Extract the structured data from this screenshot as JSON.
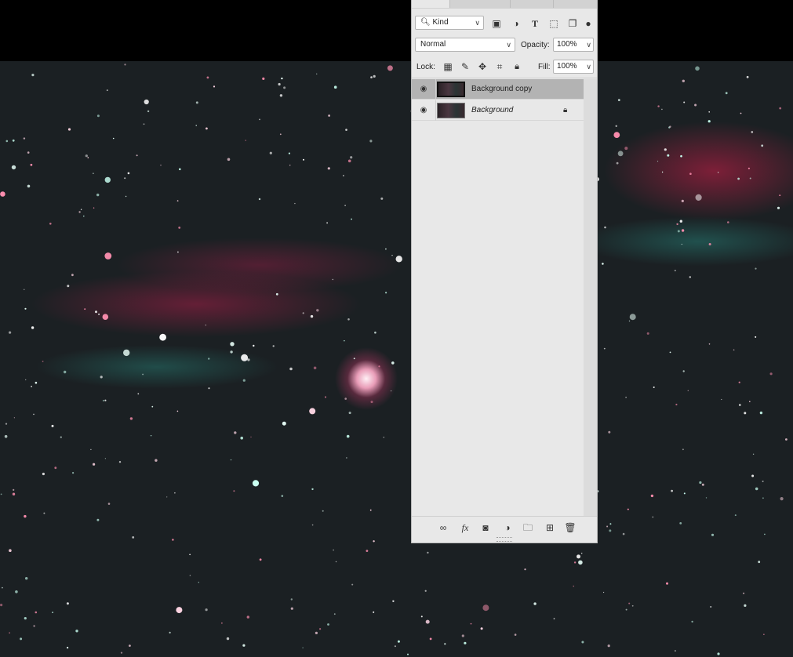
{
  "panel": {
    "tabs": [
      "",
      "",
      ""
    ],
    "filter": {
      "value": "Kind",
      "icons": [
        "image-filter-icon",
        "adjustment-filter-icon",
        "type-filter-icon",
        "shape-filter-icon",
        "smart-object-filter-icon",
        "filter-toggle-icon"
      ]
    },
    "blend_mode": "Normal",
    "opacity_label": "Opacity:",
    "opacity_value": "100%",
    "lock_label": "Lock:",
    "lock_icons": [
      "lock-transparent-pixels-icon",
      "lock-image-pixels-icon",
      "lock-position-icon",
      "lock-artboard-icon",
      "lock-all-icon"
    ],
    "fill_label": "Fill:",
    "fill_value": "100%",
    "layers": [
      {
        "name": "Background copy",
        "visible": true,
        "selected": true,
        "locked": false
      },
      {
        "name": "Background",
        "visible": true,
        "selected": false,
        "locked": true
      }
    ],
    "bottom_icons": [
      "link-layers-icon",
      "fx-icon",
      "add-mask-icon",
      "new-adjustment-layer-icon",
      "new-group-icon",
      "new-layer-icon",
      "delete-layer-icon"
    ]
  }
}
